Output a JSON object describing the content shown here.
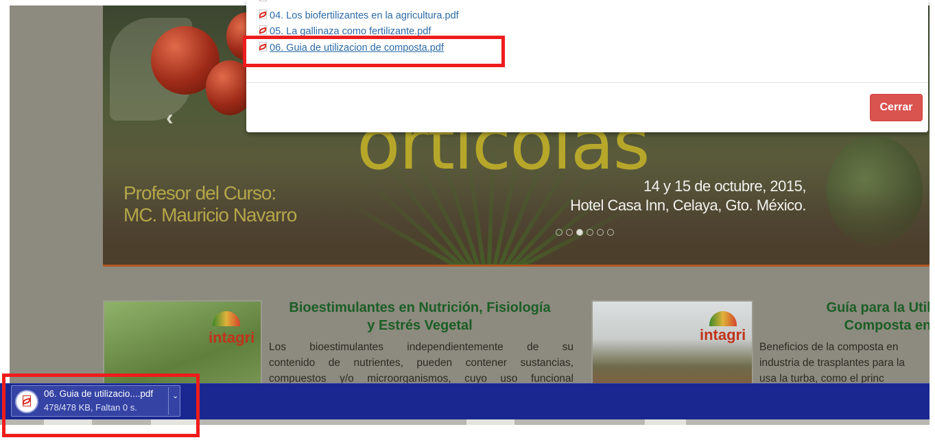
{
  "banner": {
    "title_fragment": "orticolas",
    "professor_label": "Profesor del Curso:",
    "professor_name": "MC. Mauricio Navarro",
    "event_date": "14 y 15 de octubre, 2015,",
    "event_place": "Hotel Casa Inn, Celaya, Gto. México.",
    "slide_count": 6,
    "active_slide": 3
  },
  "modal": {
    "files": [
      {
        "label": "04. Los biofertilizantes en la agricultura.pdf"
      },
      {
        "label": "05. La gallinaza como fertilizante.pdf"
      },
      {
        "label": "06. Guia de utilizacion de composta.pdf"
      }
    ],
    "close_label": "Cerrar"
  },
  "articles": [
    {
      "logo": "intagri",
      "title_line1": "Bioestimulantes en Nutrición, Fisiología",
      "title_line2": "y Estrés Vegetal",
      "text_lines": [
        "Los bioestimulantes independientemente de su",
        "contenido de nutrientes, pueden contener sustancias,",
        "compuestos y/o microorganismos, cuyo uso funcional"
      ]
    },
    {
      "logo": "intagri",
      "title_line1": "Guía para la Utiliza",
      "title_line2": "Composta en",
      "text_lines": [
        "Beneficios de la composta en",
        "industria de trasplantes para la",
        "usa la turba, como el princ"
      ]
    }
  ],
  "download": {
    "filename": "06. Guia de utilizacio....pdf",
    "status": "478/478 KB, Faltan 0 s."
  },
  "colors": {
    "highlight": "#ee1c1c",
    "download_bar": "#1a2790",
    "close_button": "#d9534f",
    "link": "#2a6aa8",
    "article_title": "#1b5e25"
  }
}
